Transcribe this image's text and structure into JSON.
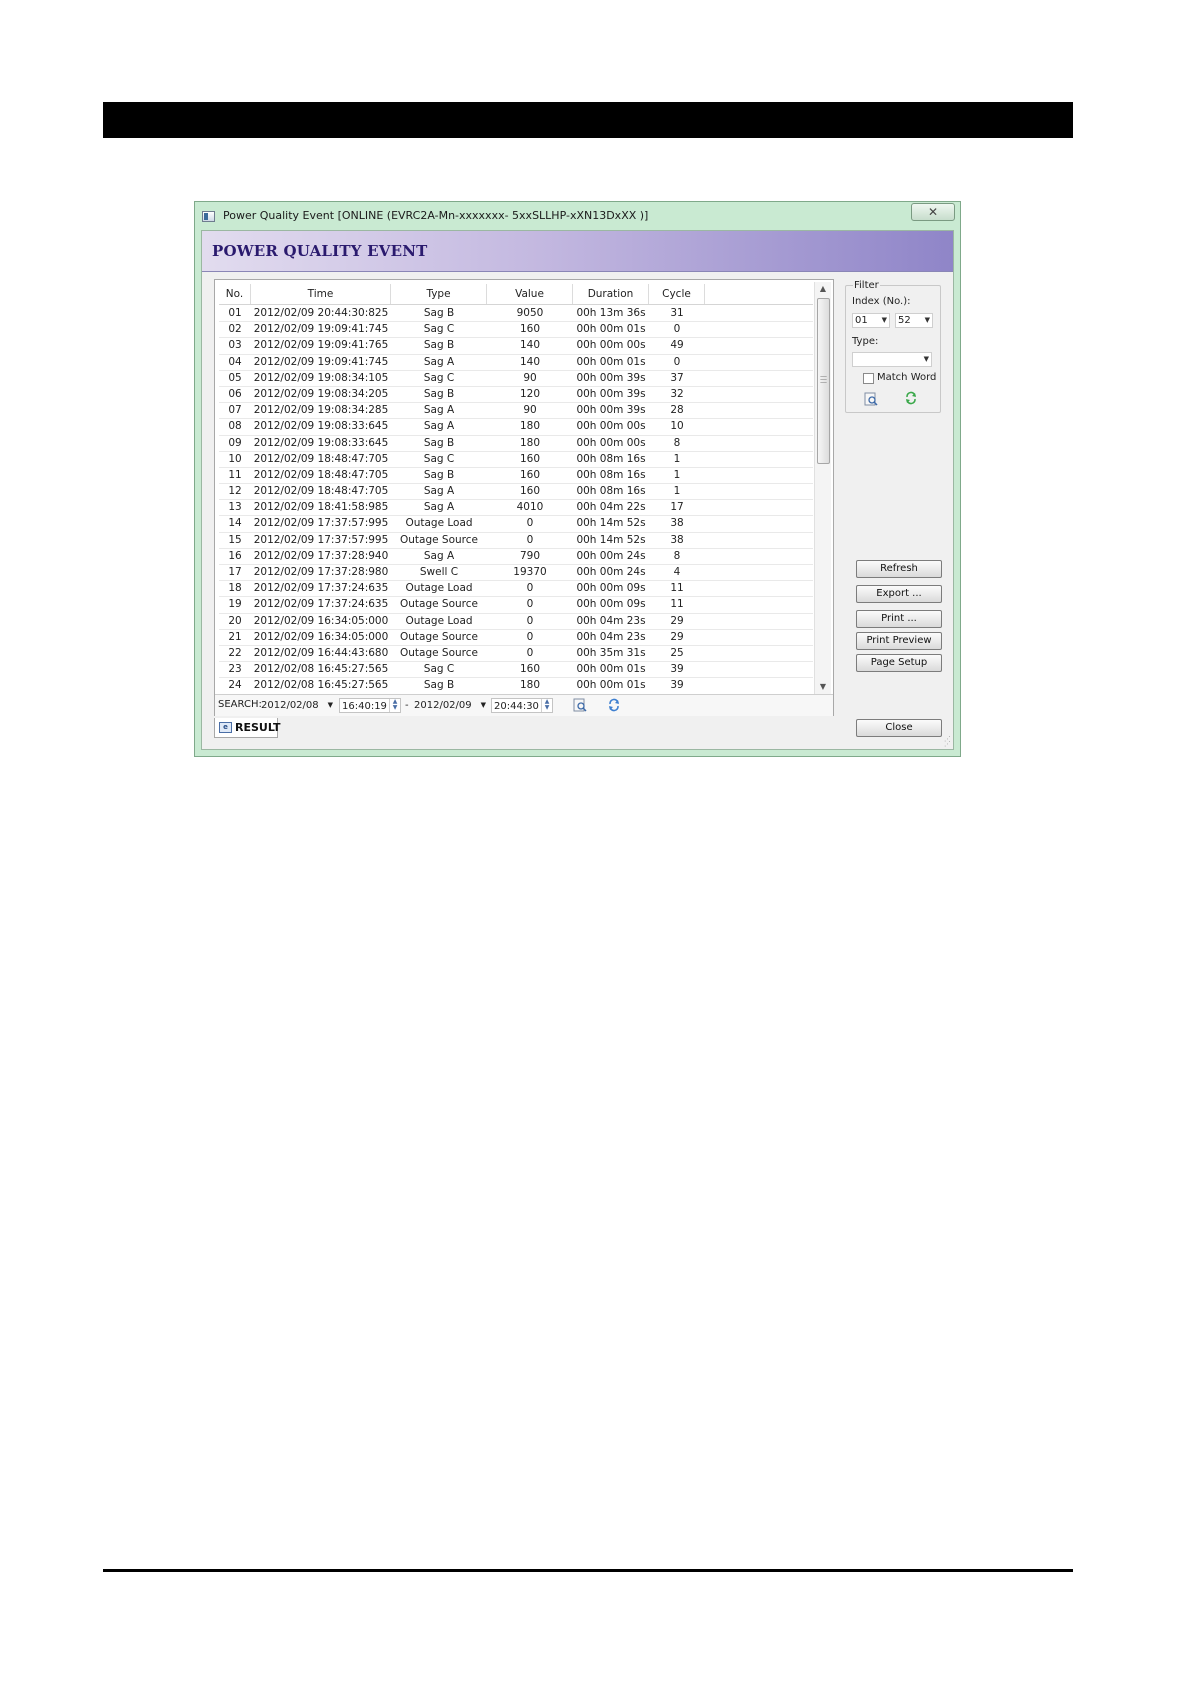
{
  "window": {
    "title": "Power Quality Event [ONLINE (EVRC2A-Mn-xxxxxxx-  5xxSLLHP-xXN13DxXX )]",
    "close_glyph": "✕"
  },
  "banner": {
    "title": "POWER QUALITY EVENT"
  },
  "table": {
    "headers": {
      "no": "No.",
      "time": "Time",
      "type": "Type",
      "value": "Value",
      "duration": "Duration",
      "cycle": "Cycle"
    },
    "rows": [
      {
        "no": "01",
        "time": "2012/02/09 20:44:30:825",
        "type": "Sag B",
        "value": "9050",
        "duration": "00h 13m 36s",
        "cycle": "31"
      },
      {
        "no": "02",
        "time": "2012/02/09 19:09:41:745",
        "type": "Sag C",
        "value": "160",
        "duration": "00h 00m 01s",
        "cycle": "0"
      },
      {
        "no": "03",
        "time": "2012/02/09 19:09:41:765",
        "type": "Sag B",
        "value": "140",
        "duration": "00h 00m 00s",
        "cycle": "49"
      },
      {
        "no": "04",
        "time": "2012/02/09 19:09:41:745",
        "type": "Sag A",
        "value": "140",
        "duration": "00h 00m 01s",
        "cycle": "0"
      },
      {
        "no": "05",
        "time": "2012/02/09 19:08:34:105",
        "type": "Sag C",
        "value": "90",
        "duration": "00h 00m 39s",
        "cycle": "37"
      },
      {
        "no": "06",
        "time": "2012/02/09 19:08:34:205",
        "type": "Sag B",
        "value": "120",
        "duration": "00h 00m 39s",
        "cycle": "32"
      },
      {
        "no": "07",
        "time": "2012/02/09 19:08:34:285",
        "type": "Sag A",
        "value": "90",
        "duration": "00h 00m 39s",
        "cycle": "28"
      },
      {
        "no": "08",
        "time": "2012/02/09 19:08:33:645",
        "type": "Sag A",
        "value": "180",
        "duration": "00h 00m 00s",
        "cycle": "10"
      },
      {
        "no": "09",
        "time": "2012/02/09 19:08:33:645",
        "type": "Sag B",
        "value": "180",
        "duration": "00h 00m 00s",
        "cycle": "8"
      },
      {
        "no": "10",
        "time": "2012/02/09 18:48:47:705",
        "type": "Sag C",
        "value": "160",
        "duration": "00h 08m 16s",
        "cycle": "1"
      },
      {
        "no": "11",
        "time": "2012/02/09 18:48:47:705",
        "type": "Sag B",
        "value": "160",
        "duration": "00h 08m 16s",
        "cycle": "1"
      },
      {
        "no": "12",
        "time": "2012/02/09 18:48:47:705",
        "type": "Sag A",
        "value": "160",
        "duration": "00h 08m 16s",
        "cycle": "1"
      },
      {
        "no": "13",
        "time": "2012/02/09 18:41:58:985",
        "type": "Sag A",
        "value": "4010",
        "duration": "00h 04m 22s",
        "cycle": "17"
      },
      {
        "no": "14",
        "time": "2012/02/09 17:37:57:995",
        "type": "Outage Load",
        "value": "0",
        "duration": "00h 14m 52s",
        "cycle": "38"
      },
      {
        "no": "15",
        "time": "2012/02/09 17:37:57:995",
        "type": "Outage Source",
        "value": "0",
        "duration": "00h 14m 52s",
        "cycle": "38"
      },
      {
        "no": "16",
        "time": "2012/02/09 17:37:28:940",
        "type": "Sag A",
        "value": "790",
        "duration": "00h 00m 24s",
        "cycle": "8"
      },
      {
        "no": "17",
        "time": "2012/02/09 17:37:28:980",
        "type": "Swell C",
        "value": "19370",
        "duration": "00h 00m 24s",
        "cycle": "4"
      },
      {
        "no": "18",
        "time": "2012/02/09 17:37:24:635",
        "type": "Outage Load",
        "value": "0",
        "duration": "00h 00m 09s",
        "cycle": "11"
      },
      {
        "no": "19",
        "time": "2012/02/09 17:37:24:635",
        "type": "Outage Source",
        "value": "0",
        "duration": "00h 00m 09s",
        "cycle": "11"
      },
      {
        "no": "20",
        "time": "2012/02/09 16:34:05:000",
        "type": "Outage Load",
        "value": "0",
        "duration": "00h 04m 23s",
        "cycle": "29"
      },
      {
        "no": "21",
        "time": "2012/02/09 16:34:05:000",
        "type": "Outage Source",
        "value": "0",
        "duration": "00h 04m 23s",
        "cycle": "29"
      },
      {
        "no": "22",
        "time": "2012/02/09 16:44:43:680",
        "type": "Outage Source",
        "value": "0",
        "duration": "00h 35m 31s",
        "cycle": "25"
      },
      {
        "no": "23",
        "time": "2012/02/08 16:45:27:565",
        "type": "Sag C",
        "value": "160",
        "duration": "00h 00m 01s",
        "cycle": "39"
      },
      {
        "no": "24",
        "time": "2012/02/08 16:45:27:565",
        "type": "Sag B",
        "value": "180",
        "duration": "00h 00m 01s",
        "cycle": "39"
      }
    ]
  },
  "search": {
    "label": "SEARCH:",
    "from_date": "2012/02/08",
    "from_time": "16:40:19",
    "separator": "-",
    "to_date": "2012/02/09",
    "to_time": "20:44:30"
  },
  "tab": {
    "result_label": "RESULT",
    "result_icon_text": "e"
  },
  "filter": {
    "legend": "Filter",
    "index_label": "Index (No.):",
    "index_from": "01",
    "index_to": "52",
    "type_label": "Type:",
    "type_value": "",
    "match_word_label": "Match Word"
  },
  "buttons": {
    "refresh": "Refresh",
    "export": "Export ...",
    "print": "Print ...",
    "print_preview": "Print Preview",
    "page_setup": "Page Setup",
    "close": "Close"
  }
}
